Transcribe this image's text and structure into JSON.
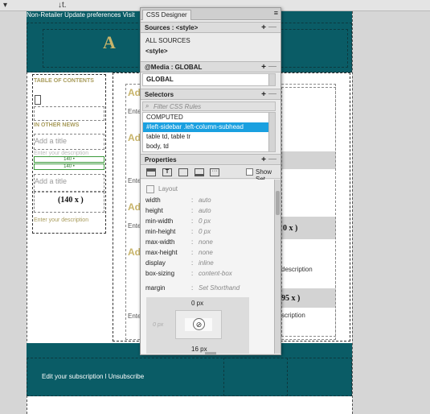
{
  "toolbar": {
    "sort_icon": "↓t."
  },
  "page": {
    "nav_text": "Non-Retailer   Update preferences   Visit",
    "header_title": "A",
    "footer_text": "Edit your subscription l Unsubscribe"
  },
  "sidebar": {
    "toc_label": "TABLE OF CONTENTS",
    "news_label": "IN OTHER NEWS",
    "add_title_1": "Add a title",
    "add_desc": "Enter your description",
    "guide_140a": "140 •",
    "guide_140b": "140 •",
    "add_title_2": "Add a title",
    "price": "(140 x )",
    "enter_desc": "Enter your description"
  },
  "main": {
    "heading_a": "Ad",
    "enter_1": "Ente",
    "enter_2": "Ente",
    "enter_3": "Ente",
    "enter_4": "Ente",
    "enter_5": "Ente",
    "price_1": "0 x )",
    "price_2": "95 x )",
    "desc_1": "description",
    "desc_2": "scription"
  },
  "panel": {
    "tab_label": "CSS Designer",
    "sources": {
      "header": "Sources : <style>",
      "items": [
        "ALL SOURCES",
        "<style>"
      ]
    },
    "media": {
      "header": "@Media : GLOBAL",
      "items": [
        "GLOBAL"
      ]
    },
    "selectors": {
      "header": "Selectors",
      "filter_placeholder": "Filter CSS Rules",
      "items": [
        "COMPUTED",
        "#left-sidebar .left-column-subhead",
        "table td, table tr",
        "body, td"
      ],
      "selected_index": 1,
      "selected_color": "#1aa0e0"
    },
    "properties": {
      "header": "Properties",
      "show_set_label": "Show Set",
      "group_label": "Layout",
      "rows": [
        {
          "name": "width",
          "value": "auto"
        },
        {
          "name": "height",
          "value": "auto"
        },
        {
          "name": "min-width",
          "value": "0 px"
        },
        {
          "name": "min-height",
          "value": "0 px"
        },
        {
          "name": "max-width",
          "value": "none"
        },
        {
          "name": "max-height",
          "value": "none"
        },
        {
          "name": "display",
          "value": "inline"
        },
        {
          "name": "box-sizing",
          "value": "content-box"
        }
      ],
      "margin_label": "margin",
      "margin_value": "Set Shorthand",
      "box_top": "0 px",
      "box_left": "0 px",
      "box_bottom": "16 px"
    }
  },
  "colors": {
    "header_teal": "#0a5c66",
    "accent_gold": "#c8b46a",
    "selection_blue": "#1aa0e0"
  }
}
